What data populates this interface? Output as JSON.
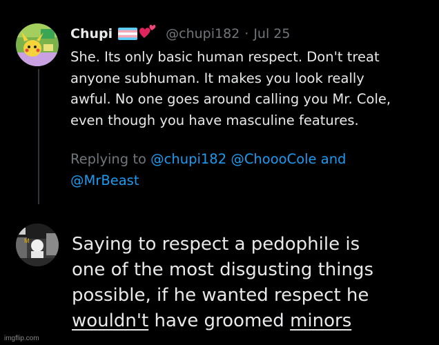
{
  "tweet1": {
    "name": "Chupi",
    "handle": "@chupi182",
    "sep": "·",
    "date": "Jul 25",
    "body": "She. Its only basic human respect. Don't treat\nanyone subhuman. It makes you look really\nawful. No one goes around calling you Mr. Cole,\neven though you have masculine features.",
    "reply_prefix": "Replying to ",
    "reply_mention1": "@chupi182",
    "reply_mention2": "@ChoooCole",
    "reply_and": " and",
    "reply_mention3": "@MrBeast"
  },
  "tweet2": {
    "line1": "Saying to respect a pedophile is",
    "line2": "one of the most disgusting things",
    "line3": "possible, if he wanted respect he",
    "underlined1": "wouldn't",
    "middle": " have groomed ",
    "underlined2": "minors"
  },
  "watermark": "imgflip.com",
  "colors": {
    "background": "#000000",
    "text": "#e7e9ea",
    "muted": "#71767b",
    "link": "#1d9bf0"
  }
}
